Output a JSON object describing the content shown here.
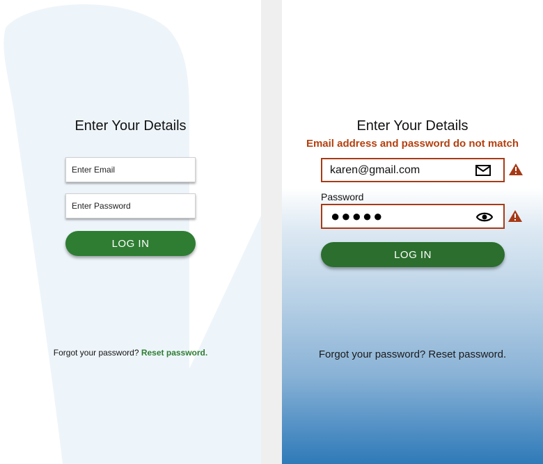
{
  "left": {
    "title": "Enter Your Details",
    "email_placeholder": "Enter Email",
    "password_placeholder": "Enter Password",
    "login_label": "LOG IN",
    "forgot_text": "Forgot your password?",
    "reset_text": "Reset password."
  },
  "right": {
    "title": "Enter Your Details",
    "error_message": "Email address and password do not match",
    "email_value": "karen@gmail.com",
    "password_label": "Password",
    "password_mask": "●●●●●",
    "login_label": "LOG IN",
    "forgot_full": "Forgot your password? Reset password.",
    "icons": [
      "mail-icon",
      "eye-icon",
      "warning-icon"
    ]
  },
  "colors": {
    "primary_green": "#2e7d32",
    "error": "#b3400f",
    "gradient_blue": "#2f7ab8"
  }
}
